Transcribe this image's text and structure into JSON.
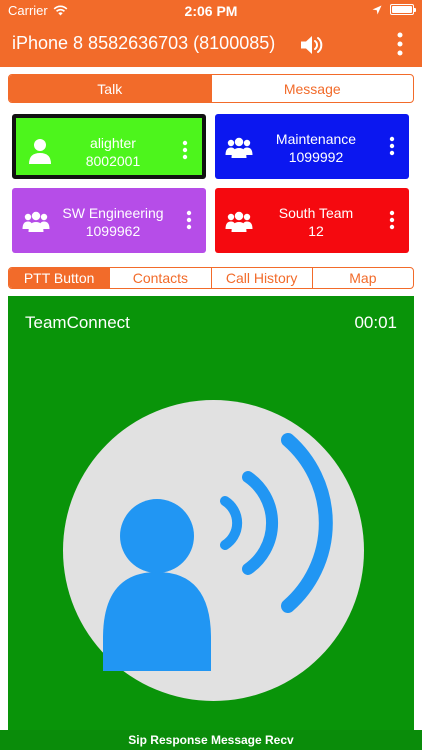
{
  "status_bar": {
    "carrier": "Carrier",
    "time": "2:06 PM",
    "icons": [
      "wifi-icon",
      "location-icon",
      "battery-icon"
    ]
  },
  "navbar": {
    "title": "iPhone 8 8582636703 (8100085)",
    "icons": [
      "speaker-icon",
      "more-vertical-icon"
    ]
  },
  "top_tabs": [
    {
      "label": "Talk",
      "active": true
    },
    {
      "label": "Message",
      "active": false
    }
  ],
  "tiles": [
    {
      "name": "alighter",
      "number": "8002001",
      "icon": "person-icon",
      "color": "#4df51c",
      "selected": true
    },
    {
      "name": "Maintenance",
      "number": "1099992",
      "icon": "group-icon",
      "color": "#0b17f0",
      "selected": false
    },
    {
      "name": "SW Engineering",
      "number": "1099962",
      "icon": "group-icon",
      "color": "#b64de8",
      "selected": false
    },
    {
      "name": "South Team",
      "number": "12",
      "icon": "group-icon",
      "color": "#f5090f",
      "selected": false
    }
  ],
  "mid_tabs": [
    {
      "label": "PTT Button",
      "active": true
    },
    {
      "label": "Contacts",
      "active": false
    },
    {
      "label": "Call History",
      "active": false
    },
    {
      "label": "Map",
      "active": false
    }
  ],
  "ptt": {
    "name": "TeamConnect",
    "timer": "00:01",
    "icon": "person-speaking-icon",
    "panel_color": "#099409",
    "icon_color": "#2196f3"
  },
  "bottom_status": "Sip Response Message Recv",
  "colors": {
    "accent": "#f26b2a"
  }
}
